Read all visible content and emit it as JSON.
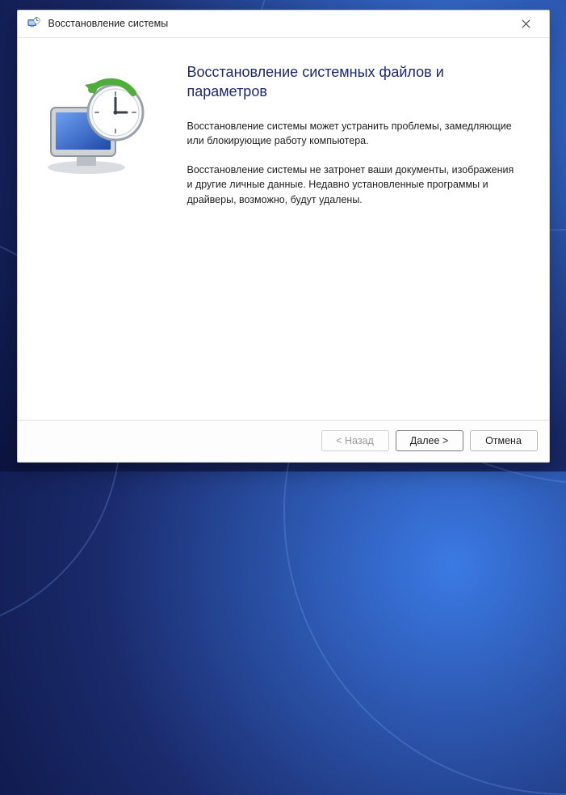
{
  "window": {
    "title": "Восстановление системы"
  },
  "main": {
    "heading": "Восстановление системных файлов и параметров",
    "paragraph1": "Восстановление системы может устранить проблемы, замедляющие или блокирующие работу компьютера.",
    "paragraph2": "Восстановление системы не затронет ваши документы, изображения и другие личные данные. Недавно установленные программы и драйверы, возможно, будут удалены."
  },
  "footer": {
    "back_label": "< Назад",
    "next_label": "Далее >",
    "cancel_label": "Отмена",
    "back_enabled": false
  },
  "icons": {
    "app": "system-restore-icon",
    "close": "close-icon",
    "illustration": "monitor-clock-restore-icon"
  }
}
